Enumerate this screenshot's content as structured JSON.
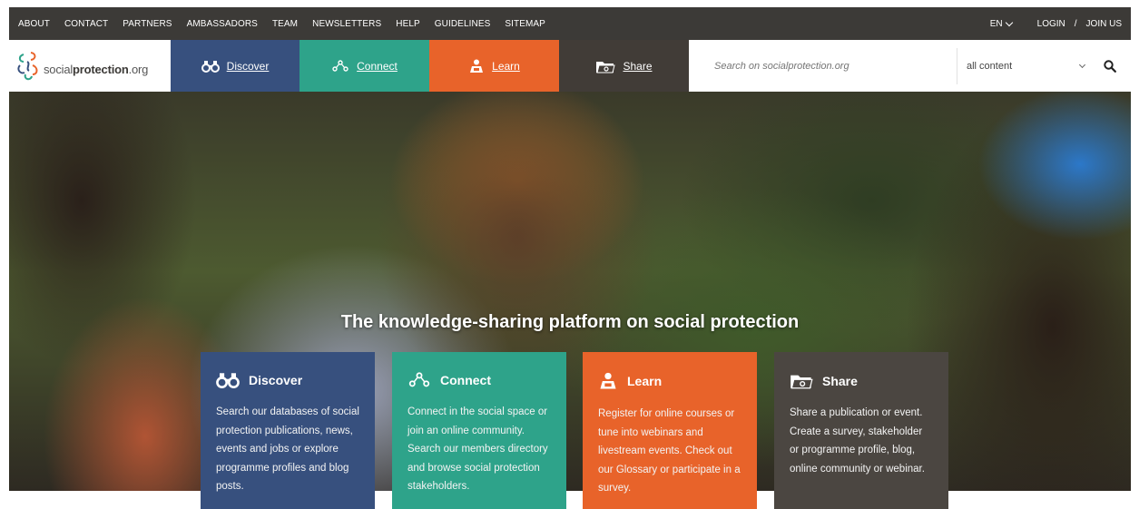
{
  "topnav": {
    "links": [
      "ABOUT",
      "CONTACT",
      "PARTNERS",
      "AMBASSADORS",
      "TEAM",
      "NEWSLETTERS",
      "HELP",
      "GUIDELINES",
      "SITEMAP"
    ],
    "lang": "EN",
    "login": "LOGIN",
    "separator": "/",
    "join": "JOIN US"
  },
  "logo": {
    "text_light": "social",
    "text_bold": "protection",
    "text_suffix": ".org"
  },
  "mainnav": {
    "discover": "Discover",
    "connect": "Connect",
    "learn": "Learn",
    "share": "Share"
  },
  "search": {
    "placeholder": "Search on socialprotection.org",
    "filter": "all content"
  },
  "hero": {
    "title": "The knowledge-sharing platform on social protection"
  },
  "cards": [
    {
      "title": "Discover",
      "body": "Search our databases of social protection publications, news, events and jobs or explore programme profiles and blog posts."
    },
    {
      "title": "Connect",
      "body": "Connect in the social space or join an online community. Search our members directory and browse social protection stakeholders."
    },
    {
      "title": "Learn",
      "body": "Register for online courses or tune into webinars and livestream events. Check out our Glossary or participate in a survey."
    },
    {
      "title": "Share",
      "body": "Share a publication or event. Create a survey, stakeholder or programme profile, blog, online community or webinar."
    }
  ],
  "colors": {
    "discover": "#37507e",
    "connect": "#2ea38a",
    "learn": "#e8632a",
    "share": "#413c37",
    "topbar": "#3c3a37"
  }
}
